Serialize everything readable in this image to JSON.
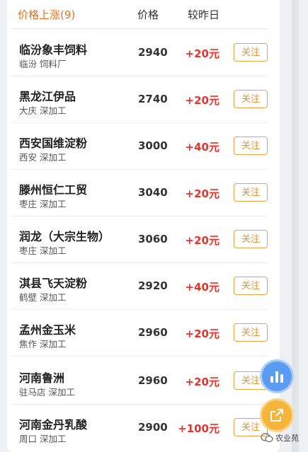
{
  "header": {
    "title": "价格上涨(9)",
    "col_price": "价格",
    "col_change": "较昨日"
  },
  "rows": [
    {
      "name": "临汾象丰饲料",
      "sub": "临汾 饲料厂",
      "price": "2940",
      "change": "+20元",
      "follow": "关注"
    },
    {
      "name": "黑龙江伊品",
      "sub": "大庆 深加工",
      "price": "2740",
      "change": "+20元",
      "follow": "关注"
    },
    {
      "name": "西安国维淀粉",
      "sub": "西安 深加工",
      "price": "3000",
      "change": "+40元",
      "follow": "关注"
    },
    {
      "name": "滕州恒仁工贸",
      "sub": "枣庄 深加工",
      "price": "3040",
      "change": "+20元",
      "follow": "关注"
    },
    {
      "name": "润龙（大宗生物）",
      "sub": "枣庄 深加工",
      "price": "3060",
      "change": "+20元",
      "follow": "关注"
    },
    {
      "name": "淇县飞天淀粉",
      "sub": "鹤壁 深加工",
      "price": "2920",
      "change": "+40元",
      "follow": "关注"
    },
    {
      "name": "孟州金玉米",
      "sub": "焦作 深加工",
      "price": "2960",
      "change": "+20元",
      "follow": "关注"
    },
    {
      "name": "河南鲁洲",
      "sub": "驻马店 深加工",
      "price": "2960",
      "change": "+20元",
      "follow": "关注"
    },
    {
      "name": "河南金丹乳酸",
      "sub": "周口 深加工",
      "price": "2900",
      "change": "+100元",
      "follow": "关注"
    }
  ],
  "fab": {
    "chart_icon": "bar-chart-icon",
    "share_icon": "share-icon"
  },
  "watermark": {
    "text": "农业苑",
    "icon": "wechat-icon"
  },
  "colors": {
    "accent_orange": "#e8711f",
    "price_up_red": "#e8322a",
    "follow_border": "#f0a040",
    "fab_blue": "#5a9cf2",
    "fab_yellow": "#f4b53a"
  }
}
